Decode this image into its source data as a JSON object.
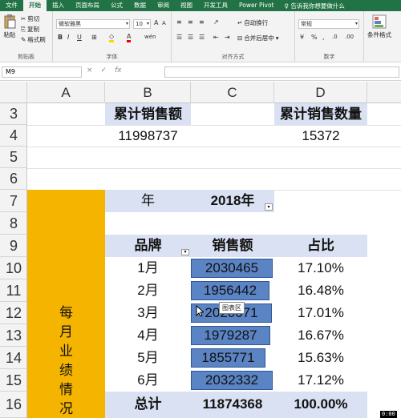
{
  "tabs": [
    "文件",
    "开始",
    "插入",
    "页面布局",
    "公式",
    "数据",
    "审阅",
    "视图",
    "开发工具",
    "Power Pivot"
  ],
  "tell_me": "告诉我你想要做什么",
  "ribbon": {
    "paste": "粘贴",
    "cut": "剪切",
    "copy": "复制",
    "format_painter": "格式刷",
    "clipboard_label": "剪贴板",
    "font_name": "微软雅黑",
    "font_size": "10",
    "font_label": "字体",
    "wrap_text": "自动换行",
    "merge_center": "合并后居中",
    "alignment_label": "对齐方式",
    "number_format": "常规",
    "number_label": "数字",
    "conditional_format": "条件格式",
    "bold": "B",
    "italic": "I",
    "underline": "U"
  },
  "formula_bar": {
    "name_box": "M9",
    "cancel": "×",
    "enter": "✓",
    "fx": "fx",
    "formula": ""
  },
  "columns": [
    "A",
    "B",
    "C",
    "D"
  ],
  "rows": [
    "3",
    "4",
    "5",
    "6",
    "7",
    "8",
    "9",
    "10",
    "11",
    "12",
    "13",
    "14",
    "15",
    "16"
  ],
  "sheet": {
    "cum_sales_label": "累计销售额",
    "cum_sales_value": "11998737",
    "cum_qty_label": "累计销售数量",
    "cum_qty_value": "15372",
    "year_label": "年",
    "year_value": "2018年",
    "merged_label_chars": [
      "每",
      "月",
      "业",
      "绩",
      "情",
      "况"
    ],
    "table_headers": {
      "brand": "品牌",
      "sales": "销售额",
      "share": "占比"
    },
    "months": [
      {
        "month": "1月",
        "sales": "2030465",
        "share": "17.10%",
        "bar": 1.0
      },
      {
        "month": "2月",
        "sales": "1956442",
        "share": "16.48%",
        "bar": 0.964
      },
      {
        "month": "3月",
        "sales": "2020071",
        "share": "17.01%",
        "bar": 0.995
      },
      {
        "month": "4月",
        "sales": "1979287",
        "share": "16.67%",
        "bar": 0.975
      },
      {
        "month": "5月",
        "sales": "1855771",
        "share": "15.63%",
        "bar": 0.914
      },
      {
        "month": "6月",
        "sales": "2032332",
        "share": "17.12%",
        "bar": 1.0
      }
    ],
    "total": {
      "label": "总计",
      "sales": "11874368",
      "share": "100.00%"
    }
  },
  "tooltip": "图表区",
  "timer": "0:00"
}
